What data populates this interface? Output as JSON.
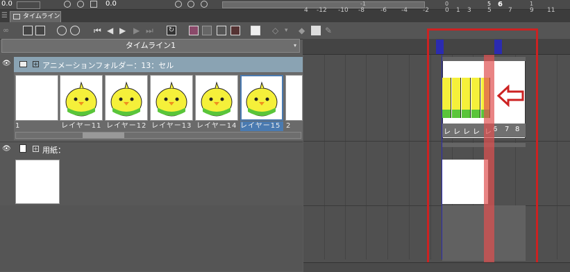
{
  "toolbar_top": {
    "value_left": "0.0",
    "value_mid": "0.0"
  },
  "tabs": [
    {
      "label": "タイムライン"
    }
  ],
  "timeline": {
    "name": "タイムライン1"
  },
  "ruler": {
    "labels": [
      "4",
      "-12",
      "-10",
      "-8",
      "-6",
      "-4",
      "-2",
      "0",
      "1",
      "3",
      "5",
      "7",
      "9",
      "11"
    ],
    "top_labels": [
      "-1",
      "0",
      "5",
      "6",
      "1"
    ]
  },
  "layers": [
    {
      "name": "アニメーションフォルダー：13：セル",
      "cells": [
        {
          "label": "1"
        },
        {
          "label": "レイヤー11"
        },
        {
          "label": "レイヤー12"
        },
        {
          "label": "レイヤー13"
        },
        {
          "label": "レイヤー14"
        },
        {
          "label": "レイヤー15"
        },
        {
          "label": "2"
        }
      ]
    },
    {
      "name": "用紙："
    }
  ],
  "frames": {
    "cell_labels": [
      "レ",
      "レ",
      "レ",
      "レ",
      "レ",
      "6",
      "7",
      "8"
    ]
  },
  "colors": {
    "accent": "#cc2222",
    "selection": "#4a7ab0",
    "playhead": "#e05050"
  }
}
